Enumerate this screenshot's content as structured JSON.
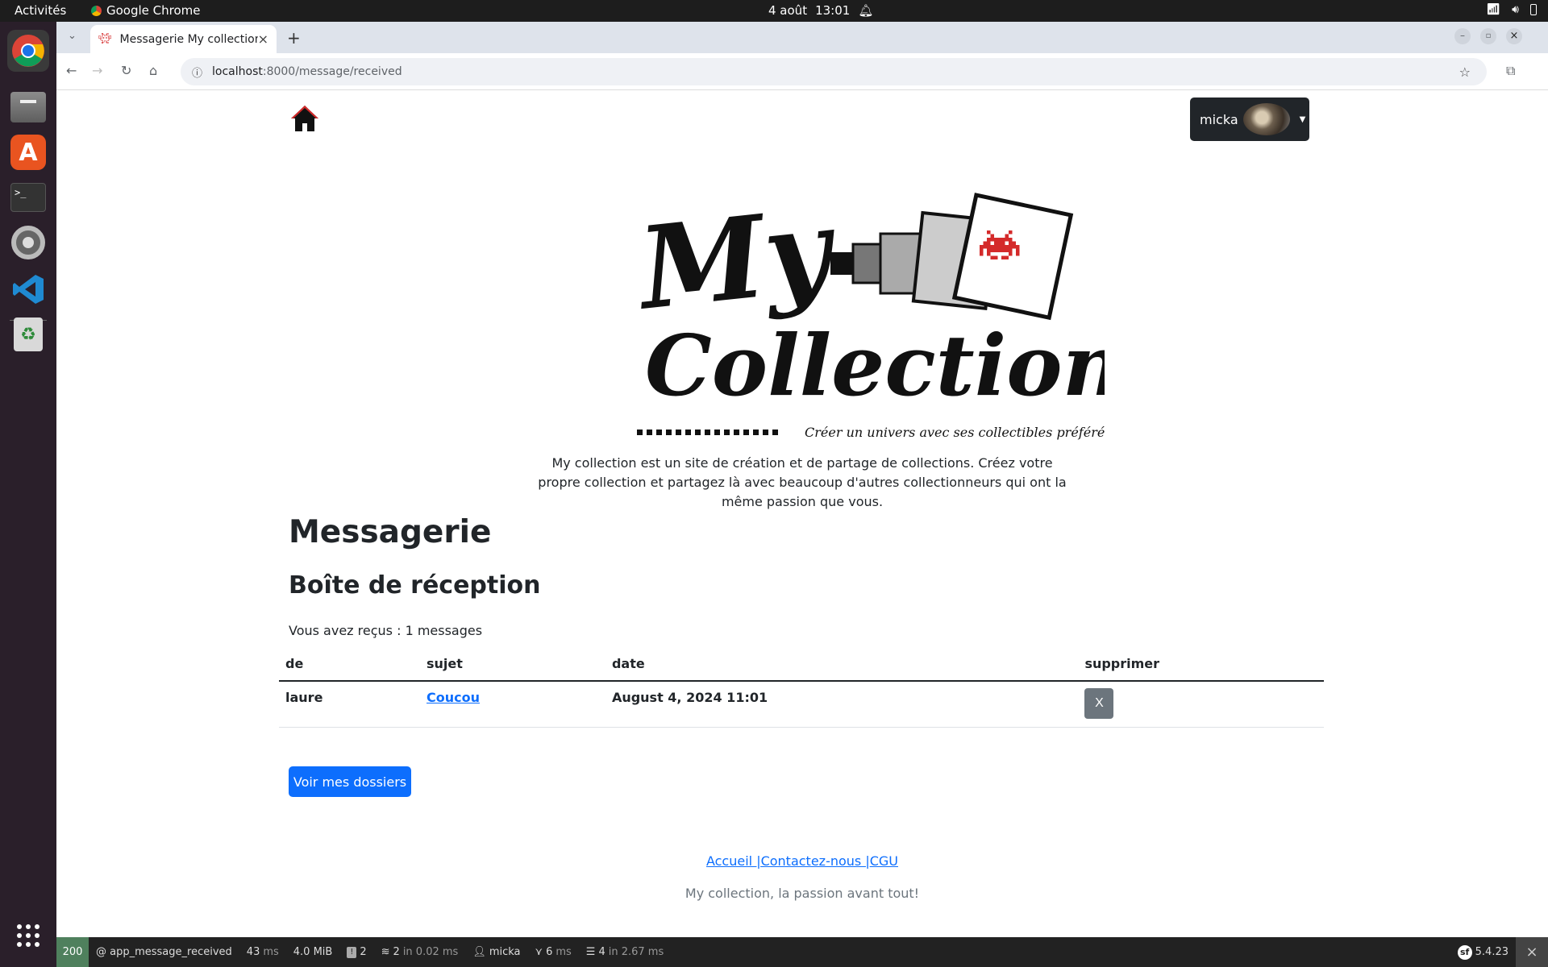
{
  "system": {
    "activities": "Activités",
    "app_name": "Google Chrome",
    "date": "4 août",
    "time": "13:01"
  },
  "browser": {
    "tab_title": "Messagerie My collection",
    "url_host": "localhost",
    "url_path": ":8000/message/received"
  },
  "page": {
    "user_name": "micka",
    "logo_title_line1": "My",
    "logo_title_line2": "Collection",
    "logo_tagline": "Créer un univers avec ses collectibles préférés",
    "intro": "My collection est un site de création et de partage de collections. Créez votre propre collection et partagez là avec beaucoup d'autres collectionneurs qui ont la même passion que vous.",
    "heading": "Messagerie",
    "subheading": "Boîte de réception",
    "count_text": "Vous avez reçus : 1 messages",
    "table": {
      "headers": [
        "de",
        "sujet",
        "date",
        "supprimer"
      ],
      "rows": [
        {
          "from": "laure",
          "subject": "Coucou",
          "date": "August 4, 2024 11:01",
          "delete_label": "X"
        }
      ]
    },
    "folders_button": "Voir mes dossiers",
    "footer_links": [
      "Accueil |",
      "Contactez-nous |",
      "CGU"
    ],
    "footer_text": "My collection, la passion avant tout!"
  },
  "symfony_toolbar": {
    "status": "200",
    "route": "@ app_message_received",
    "time_value": "43",
    "time_unit": "ms",
    "memory": "4.0 MiB",
    "logs": "2",
    "cache": "2",
    "cache_time": "in 0.02 ms",
    "user": "micka",
    "twig_time": "6",
    "twig_unit": "ms",
    "db_queries": "4",
    "db_time": "in 2.67 ms",
    "version": "5.4.23"
  },
  "colors": {
    "primary": "#0d6efd",
    "dark": "#212529",
    "secondary": "#6c757d",
    "invader_red": "#d42a2a",
    "sf_status_green": "#4f805d"
  }
}
